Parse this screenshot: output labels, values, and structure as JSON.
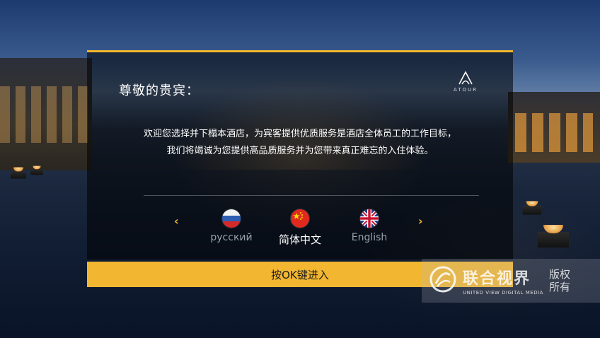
{
  "panel": {
    "greeting": "尊敬的贵宾：",
    "logo_text": "ATOUR",
    "welcome_line1": "欢迎您选择并下榻本酒店，为宾客提供优质服务是酒店全体员工的工作目标，",
    "welcome_line2": "我们将竭诚为您提供高品质服务并为您带来真正难忘的入住体验。"
  },
  "language_selector": {
    "prev_arrow": "‹",
    "next_arrow": "›",
    "languages": [
      {
        "label": "русский",
        "flag": "russia-flag-icon",
        "selected": false
      },
      {
        "label": "简体中文",
        "flag": "china-flag-icon",
        "selected": true
      },
      {
        "label": "English",
        "flag": "uk-flag-icon",
        "selected": false
      }
    ]
  },
  "enter_bar": {
    "label": "按OK键进入"
  },
  "watermark": {
    "brand_cn": "联合视界",
    "brand_en": "UNITED VIEW DIGITAL MEDIA",
    "rights_line1": "版权",
    "rights_line2": "所有"
  },
  "colors": {
    "accent": "#f2b630",
    "panel_bg": "rgba(0,0,0,0.55)",
    "inactive_label": "#9aa0a8"
  }
}
